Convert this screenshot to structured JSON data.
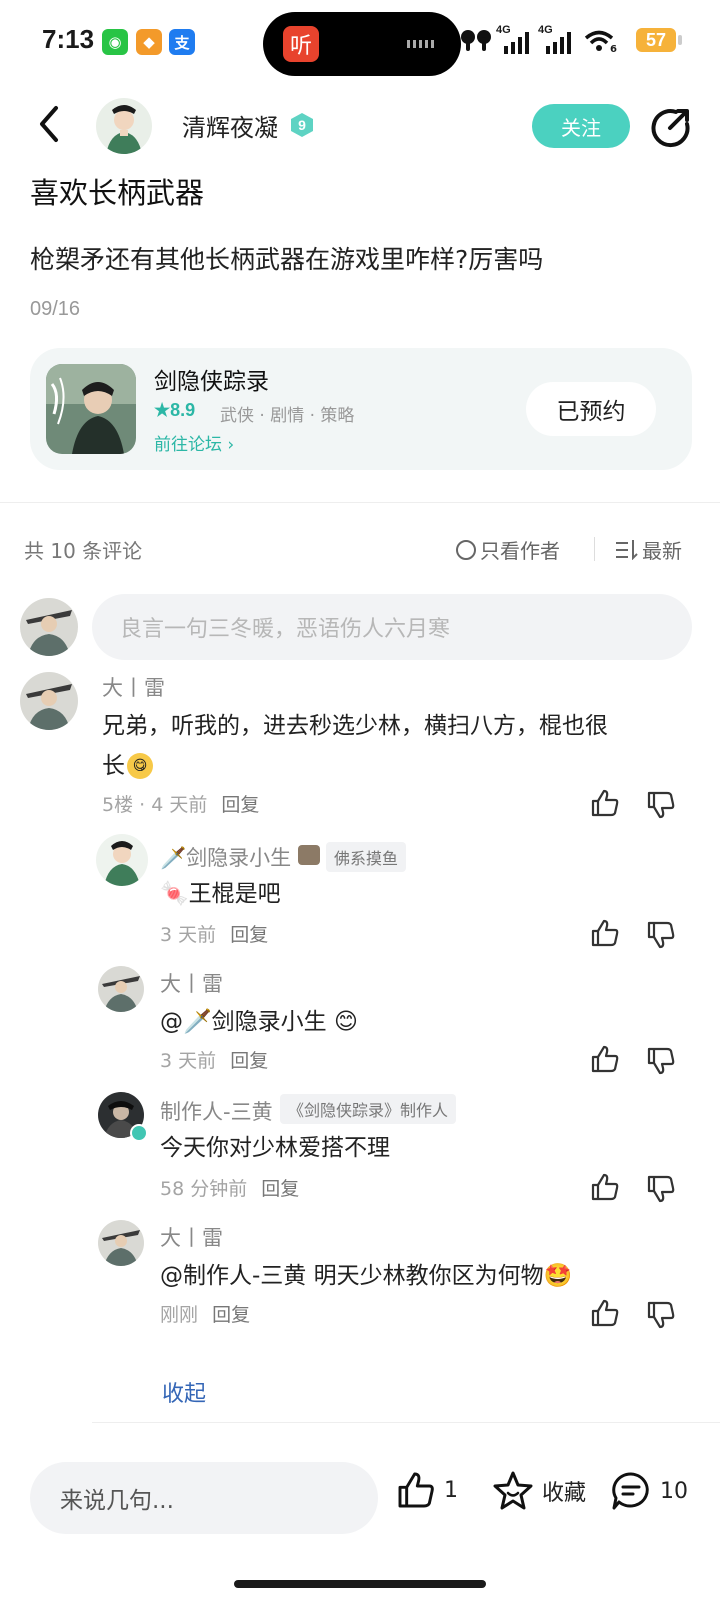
{
  "status_bar": {
    "time": "7:13",
    "net1": "4G",
    "net2": "4G",
    "battery": "57",
    "wifi_sub": "6",
    "island_app_glyph": "听"
  },
  "header": {
    "author_name": "清辉夜凝",
    "level_badge": "9",
    "follow_label": "关注"
  },
  "post": {
    "title": "喜欢长柄武器",
    "body": "枪槊矛还有其他长柄武器在游戏里咋样?厉害吗",
    "date": "09/16"
  },
  "game_card": {
    "name": "剑隐侠踪录",
    "rating": "★8.9",
    "tags": "武侠 · 剧情 · 策略",
    "forum_link": "前往论坛",
    "reserve_label": "已预约"
  },
  "comments_header": {
    "count_label": "共 10 条评论",
    "only_author_label": "只看作者",
    "sort_label": "最新"
  },
  "comment_input_placeholder": "良言一句三冬暖，恶语伤人六月寒",
  "comments": [
    {
      "name": "大丨雷",
      "text_line1": "兄弟，听我的，进去秒选少林，横扫八方，棍也很",
      "text_line2": "长",
      "meta": "5楼 · 4 天前",
      "reply_label": "回复"
    },
    {
      "name": "🗡️剑隐录小生",
      "tag": "佛系摸鱼",
      "text": "🍬王棍是吧",
      "meta": "3 天前",
      "reply_label": "回复"
    },
    {
      "name": "大丨雷",
      "text": "@🗡️剑隐录小生  😊",
      "meta": "3 天前",
      "reply_label": "回复"
    },
    {
      "name": "制作人-三黄",
      "tag": "《剑隐侠踪录》制作人",
      "text": "今天你对少林爱搭不理",
      "meta": "58 分钟前",
      "reply_label": "回复"
    },
    {
      "name": "大丨雷",
      "text": "@制作人-三黄  明天少林教你区为何物🤩",
      "meta": "刚刚",
      "reply_label": "回复"
    }
  ],
  "collapse_label": "收起",
  "bottom_bar": {
    "input_placeholder": "来说几句...",
    "like_count": "1",
    "favorite_label": "收藏",
    "comment_count": "10"
  },
  "colors": {
    "accent": "#4bd1c0",
    "teal_text": "#2cb7a6",
    "link_blue": "#3466b6",
    "battery": "#f6b23a"
  }
}
